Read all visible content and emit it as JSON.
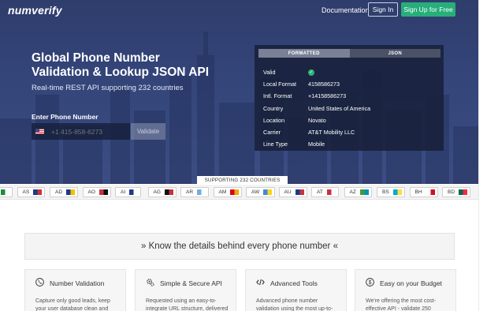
{
  "header": {
    "logo": "numverify",
    "documentation": "Documentation",
    "sign_in": "Sign In",
    "sign_up": "Sign Up for Free"
  },
  "hero": {
    "headline_line1": "Global Phone Number",
    "headline_line2": "Validation & Lookup JSON API",
    "subheadline": "Real-time REST API supporting 232 countries",
    "enter_label": "Enter Phone Number",
    "phone_placeholder": "+1 415-858-6273",
    "validate_label": "Validate"
  },
  "result_panel": {
    "tabs": [
      {
        "label": "FORMATTED",
        "active": true
      },
      {
        "label": "JSON",
        "active": false
      }
    ],
    "rows": [
      {
        "key": "Valid",
        "value": "",
        "is_check": true
      },
      {
        "key": "Local Format",
        "value": "4158586273"
      },
      {
        "key": "Intl. Format",
        "value": "+14158586273"
      },
      {
        "key": "Country",
        "value": "United States of America"
      },
      {
        "key": "Location",
        "value": "Novato"
      },
      {
        "key": "Carrier",
        "value": "AT&T Mobility LLC"
      },
      {
        "key": "Line Type",
        "value": "Mobile"
      }
    ]
  },
  "countries_label": "SUPPORTING 232 COUNTRIES",
  "country_chips": [
    {
      "code": "DZ",
      "flag": [
        "#1f8a3a",
        "#ffffff"
      ]
    },
    {
      "code": "AS",
      "flag": [
        "#1f3a8a",
        "#c8323b"
      ]
    },
    {
      "code": "AD",
      "flag": [
        "#1f3a8a",
        "#f2c200"
      ]
    },
    {
      "code": "AO",
      "flag": [
        "#c8323b",
        "#111111"
      ]
    },
    {
      "code": "AI",
      "flag": [
        "#1f3a8a",
        "#ffffff"
      ]
    },
    {
      "code": "AG",
      "flag": [
        "#111111",
        "#c8323b"
      ]
    },
    {
      "code": "AR",
      "flag": [
        "#74acdf",
        "#ffffff"
      ]
    },
    {
      "code": "AM",
      "flag": [
        "#d90012",
        "#f2a800"
      ]
    },
    {
      "code": "AW",
      "flag": [
        "#4189dd",
        "#f9d616"
      ]
    },
    {
      "code": "AU",
      "flag": [
        "#1f3a8a",
        "#c8323b"
      ]
    },
    {
      "code": "AT",
      "flag": [
        "#c8323b",
        "#ffffff"
      ]
    },
    {
      "code": "AZ",
      "flag": [
        "#3f9c35",
        "#0092bc"
      ]
    },
    {
      "code": "BS",
      "flag": [
        "#00abc9",
        "#fae042"
      ]
    },
    {
      "code": "BH",
      "flag": [
        "#ffffff",
        "#ce1126"
      ]
    },
    {
      "code": "BD",
      "flag": [
        "#006a4e",
        "#f42a41"
      ]
    }
  ],
  "details_banner": "» Know the details behind every phone number «",
  "features": [
    {
      "title": "Number Validation",
      "icon": "phone-icon",
      "body": "Capture only good leads, keep your user database clean and"
    },
    {
      "title": "Simple & Secure API",
      "icon": "gears-icon",
      "body": "Requested using an easy-to-integrate URL structure, delivered"
    },
    {
      "title": "Advanced Tools",
      "icon": "code-icon",
      "body": "Advanced phone number validation using the most up-to-"
    },
    {
      "title": "Easy on your Budget",
      "icon": "dollar-icon",
      "body": "We're offering the most cost-effective API - validate 250"
    }
  ]
}
